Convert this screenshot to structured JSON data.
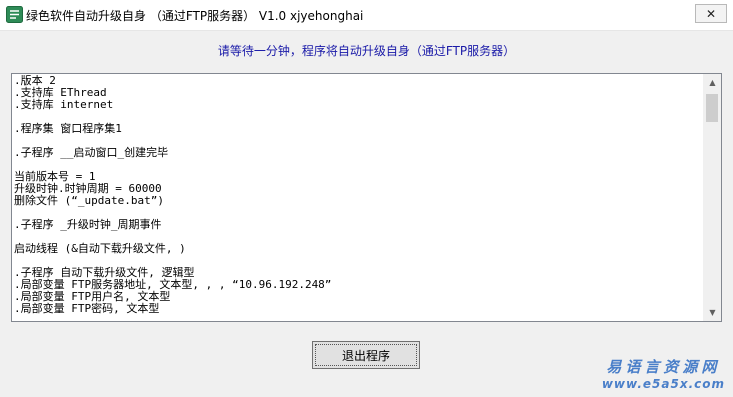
{
  "window": {
    "title": "绿色软件自动升级自身  （通过FTP服务器）  V1.0 xjyehonghai",
    "close_glyph": "✕"
  },
  "notice": "请等待一分钟，程序将自动升级自身（通过FTP服务器）",
  "code_lines": [
    ".版本 2",
    ".支持库 EThread",
    ".支持库 internet",
    "",
    ".程序集 窗口程序集1",
    "",
    ".子程序 __启动窗口_创建完毕",
    "",
    "当前版本号 = 1",
    "升级时钟.时钟周期 = 60000",
    "删除文件 (“_update.bat”)",
    "",
    ".子程序 _升级时钟_周期事件",
    "",
    "启动线程 (&自动下载升级文件, )",
    "",
    ".子程序 自动下载升级文件, 逻辑型",
    ".局部变量 FTP服务器地址, 文本型, , , “10.96.192.248”",
    ".局部变量 FTP用户名, 文本型",
    ".局部变量 FTP密码, 文本型"
  ],
  "exit_button": "退出程序",
  "watermark": {
    "line1": "易语言资源网",
    "line2": "www.e5a5x.com"
  },
  "colors": {
    "notice": "#1a1aa8",
    "watermark": "#4a7fc9"
  }
}
